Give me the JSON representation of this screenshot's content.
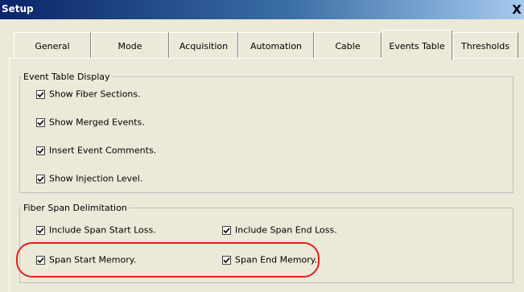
{
  "window": {
    "title": "Setup",
    "close_glyph": "X"
  },
  "tabs": [
    {
      "label": "General",
      "active": false
    },
    {
      "label": "Mode",
      "active": false
    },
    {
      "label": "Acquisition",
      "active": false
    },
    {
      "label": "Automation",
      "active": false
    },
    {
      "label": "Cable",
      "active": false
    },
    {
      "label": "Events Table",
      "active": true
    },
    {
      "label": "Thresholds",
      "active": false
    }
  ],
  "event_table_display": {
    "legend": "Event Table Display",
    "options": [
      {
        "label": "Show Fiber Sections.",
        "checked": true
      },
      {
        "label": "Show Merged Events.",
        "checked": true
      },
      {
        "label": "Insert Event Comments.",
        "checked": true
      },
      {
        "label": "Show Injection Level.",
        "checked": true
      }
    ]
  },
  "fiber_span": {
    "legend": "Fiber Span Delimitation",
    "options": [
      {
        "label": "Include Span Start Loss.",
        "checked": true
      },
      {
        "label": "Include Span End Loss.",
        "checked": true
      },
      {
        "label": "Span Start Memory.",
        "checked": true
      },
      {
        "label": "Span End Memory.",
        "checked": true
      }
    ]
  },
  "colors": {
    "highlight": "#e0201c",
    "titlebar": "#0a246a",
    "background": "#ece9d8"
  }
}
